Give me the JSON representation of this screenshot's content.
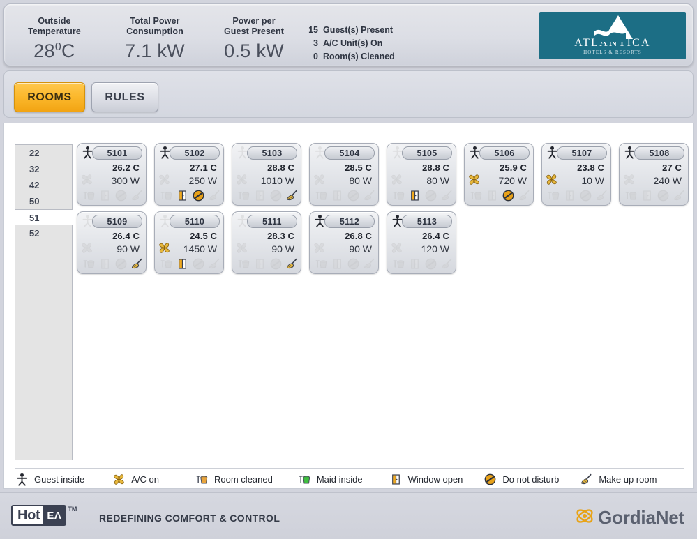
{
  "header": {
    "kpis": [
      {
        "label_line1": "Outside",
        "label_line2": "Temperature",
        "value": "28",
        "unit_sup": "0",
        "unit": "C"
      },
      {
        "label_line1": "Total Power",
        "label_line2": "Consumption",
        "value": "7.1 kW"
      },
      {
        "label_line1": "Power per",
        "label_line2": "Guest Present",
        "value": "0.5 kW"
      }
    ],
    "counters": [
      {
        "num": "15",
        "text": "Guest(s) Present"
      },
      {
        "num": "3",
        "text": "A/C Unit(s) On"
      },
      {
        "num": "0",
        "text": "Room(s) Cleaned"
      }
    ],
    "brand": {
      "name": "ATLANTICA",
      "subtitle": "HOTELS & RESORTS",
      "color": "#1c6e85"
    }
  },
  "tabs": [
    {
      "label": "ROOMS",
      "active": true
    },
    {
      "label": "RULES",
      "active": false
    }
  ],
  "floors": {
    "items": [
      "22",
      "32",
      "42",
      "50",
      "51",
      "52"
    ],
    "selected": "51"
  },
  "rooms": [
    {
      "number": "5101",
      "temp": "26.2 C",
      "power": "300 W",
      "guest": true,
      "ac": false,
      "cleaned": false,
      "maid": false,
      "window": false,
      "dnd": false,
      "makeup": false
    },
    {
      "number": "5102",
      "temp": "27.1 C",
      "power": "250 W",
      "guest": true,
      "ac": false,
      "cleaned": false,
      "maid": false,
      "window": true,
      "dnd": true,
      "makeup": false
    },
    {
      "number": "5103",
      "temp": "28.8 C",
      "power": "1010 W",
      "guest": false,
      "ac": false,
      "cleaned": false,
      "maid": false,
      "window": false,
      "dnd": false,
      "makeup": true
    },
    {
      "number": "5104",
      "temp": "28.5 C",
      "power": "80 W",
      "guest": false,
      "ac": false,
      "cleaned": false,
      "maid": false,
      "window": false,
      "dnd": false,
      "makeup": false
    },
    {
      "number": "5105",
      "temp": "28.8 C",
      "power": "80 W",
      "guest": false,
      "ac": false,
      "cleaned": false,
      "maid": false,
      "window": true,
      "dnd": false,
      "makeup": false
    },
    {
      "number": "5106",
      "temp": "25.9 C",
      "power": "720 W",
      "guest": true,
      "ac": true,
      "cleaned": false,
      "maid": false,
      "window": false,
      "dnd": true,
      "makeup": false
    },
    {
      "number": "5107",
      "temp": "23.8 C",
      "power": "10 W",
      "guest": true,
      "ac": true,
      "cleaned": false,
      "maid": false,
      "window": false,
      "dnd": false,
      "makeup": false
    },
    {
      "number": "5108",
      "temp": "27 C",
      "power": "240 W",
      "guest": true,
      "ac": false,
      "cleaned": false,
      "maid": false,
      "window": false,
      "dnd": false,
      "makeup": false
    },
    {
      "number": "5109",
      "temp": "26.4 C",
      "power": "90 W",
      "guest": false,
      "ac": false,
      "cleaned": false,
      "maid": false,
      "window": false,
      "dnd": false,
      "makeup": true
    },
    {
      "number": "5110",
      "temp": "24.5 C",
      "power": "1450 W",
      "guest": false,
      "ac": true,
      "cleaned": false,
      "maid": false,
      "window": true,
      "dnd": false,
      "makeup": false
    },
    {
      "number": "5111",
      "temp": "28.3 C",
      "power": "90 W",
      "guest": false,
      "ac": false,
      "cleaned": false,
      "maid": false,
      "window": false,
      "dnd": false,
      "makeup": true
    },
    {
      "number": "5112",
      "temp": "26.8 C",
      "power": "90 W",
      "guest": true,
      "ac": false,
      "cleaned": false,
      "maid": false,
      "window": false,
      "dnd": false,
      "makeup": false
    },
    {
      "number": "5113",
      "temp": "26.4 C",
      "power": "120 W",
      "guest": true,
      "ac": false,
      "cleaned": false,
      "maid": false,
      "window": false,
      "dnd": false,
      "makeup": false
    }
  ],
  "legend": [
    {
      "icon": "guest-inside-icon",
      "label": "Guest inside"
    },
    {
      "icon": "ac-on-icon",
      "label": "A/C on"
    },
    {
      "icon": "room-cleaned-icon",
      "label": "Room cleaned"
    },
    {
      "icon": "maid-inside-icon",
      "label": "Maid inside"
    },
    {
      "icon": "window-open-icon",
      "label": "Window open"
    },
    {
      "icon": "do-not-disturb-icon",
      "label": "Do not disturb"
    },
    {
      "icon": "make-up-room-icon",
      "label": "Make up room"
    }
  ],
  "footer": {
    "logo_hot": "Hot",
    "logo_el": "ΕΛ",
    "logo_tm": "TM",
    "tagline": "REDEFINING COMFORT & CONTROL",
    "vendor": "GordiaNet"
  },
  "colors": {
    "accent_orange": "#f2a413",
    "brand_teal": "#1c6e85",
    "panel_bg": "#ffffff",
    "page_bg": "#d2d4dd"
  }
}
